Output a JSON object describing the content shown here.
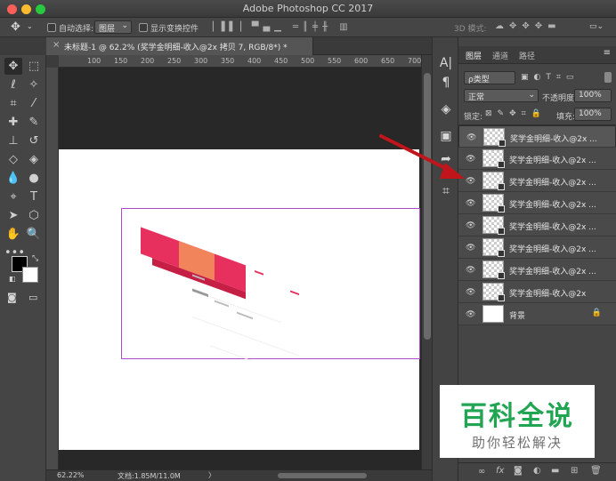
{
  "window": {
    "title": "Adobe Photoshop CC 2017"
  },
  "options_bar": {
    "auto_select_label": "自动选择:",
    "auto_select_value": "图层",
    "show_transform_label": "显示变换控件",
    "mode_3d_label": "3D 模式:"
  },
  "document": {
    "tab_title": "未标题-1 @ 62.2% (奖学金明细-收入@2x 拷贝 7, RGB/8*) *",
    "ruler_marks": [
      "100",
      "150",
      "200",
      "250",
      "300",
      "350",
      "400",
      "450",
      "500",
      "550",
      "600",
      "650",
      "700"
    ]
  },
  "status": {
    "zoom": "62.22%",
    "doc_size": "文档:1.85M/11.0M"
  },
  "layers_panel": {
    "tabs": [
      "图层",
      "通道",
      "路径"
    ],
    "filter_label": "ρ类型",
    "blend_mode": "正常",
    "opacity_label": "不透明度:",
    "opacity_value": "100%",
    "lock_label": "锁定:",
    "fill_label": "填充:",
    "fill_value": "100%",
    "layers": [
      {
        "name": "奖学金明细-收入@2x ...",
        "selected": true
      },
      {
        "name": "奖学金明细-收入@2x ..."
      },
      {
        "name": "奖学金明细-收入@2x ..."
      },
      {
        "name": "奖学金明细-收入@2x ..."
      },
      {
        "name": "奖学金明细-收入@2x ..."
      },
      {
        "name": "奖学金明细-收入@2x ..."
      },
      {
        "name": "奖学金明细-收入@2x ..."
      },
      {
        "name": "奖学金明细-收入@2x"
      },
      {
        "name": "背景",
        "locked": true
      }
    ]
  },
  "watermark": {
    "title": "百科全说",
    "subtitle": "助你轻松解决"
  },
  "colors": {
    "accent_arrow": "#c0151b",
    "selection_border": "#b04bc6",
    "watermark_green": "#21a553"
  }
}
